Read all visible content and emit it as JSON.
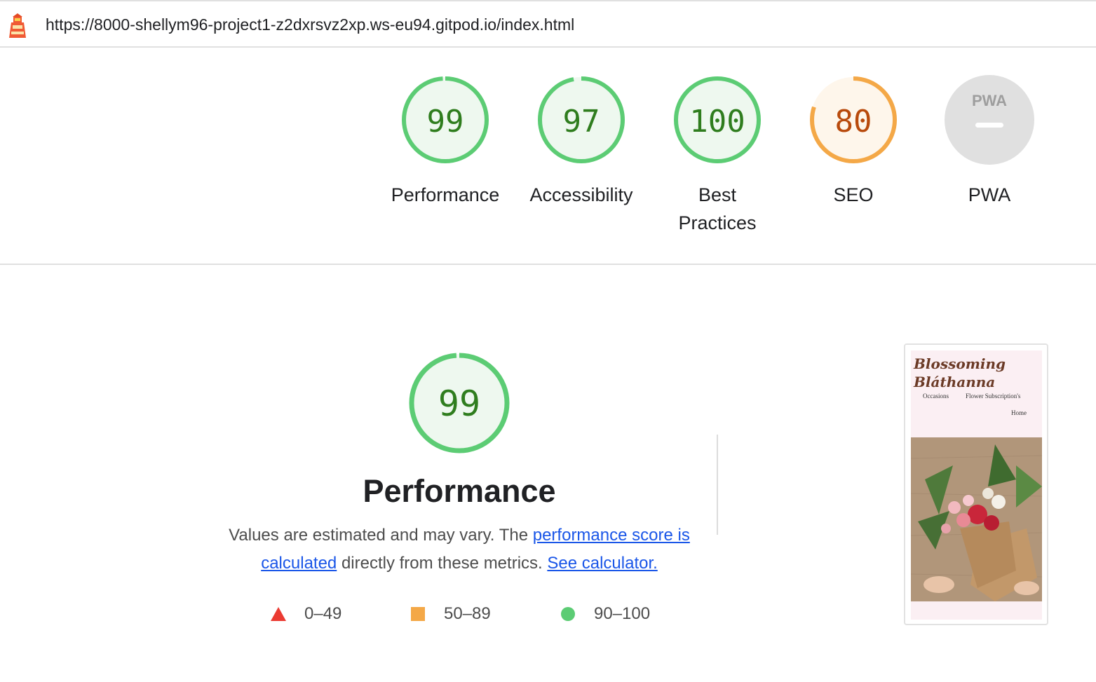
{
  "header": {
    "url": "https://8000-shellym96-project1-z2dxrsvz2xp.ws-eu94.gitpod.io/index.html"
  },
  "gauges": [
    {
      "label": "Performance",
      "score": "99",
      "value": 99,
      "status": "pass"
    },
    {
      "label": "Accessibility",
      "score": "97",
      "value": 97,
      "status": "pass"
    },
    {
      "label": "Best Practices",
      "score": "100",
      "value": 100,
      "status": "pass"
    },
    {
      "label": "SEO",
      "score": "80",
      "value": 80,
      "status": "average"
    },
    {
      "label": "PWA",
      "score": "",
      "value": null,
      "status": "na",
      "badge": "PWA"
    }
  ],
  "performance": {
    "score": "99",
    "value": 99,
    "title": "Performance",
    "desc_prefix": "Values are estimated and may vary. The",
    "desc_link": "performance score is calculated",
    "desc_mid": "directly from these metrics.",
    "desc_link2": "See calculator."
  },
  "legend": [
    {
      "range": "0–49",
      "shape": "triangle",
      "color": "#eb3b32"
    },
    {
      "range": "50–89",
      "shape": "square",
      "color": "#f4a847"
    },
    {
      "range": "90–100",
      "shape": "circle",
      "color": "#5ccc74"
    }
  ],
  "thumbnail": {
    "title_line1": "Blossoming",
    "title_line2": "Bláthanna",
    "nav_occasions": "Occasions",
    "nav_subscriptions": "Flower Subscription's",
    "nav_home": "Home"
  },
  "colors": {
    "pass": "#5ccc74",
    "pass_text": "#2f7d1e",
    "pass_fill": "#eef8ef",
    "average": "#f4a847",
    "average_text": "#b84a0c",
    "average_fill": "#fef6eb",
    "na": "#e0e0e0"
  }
}
